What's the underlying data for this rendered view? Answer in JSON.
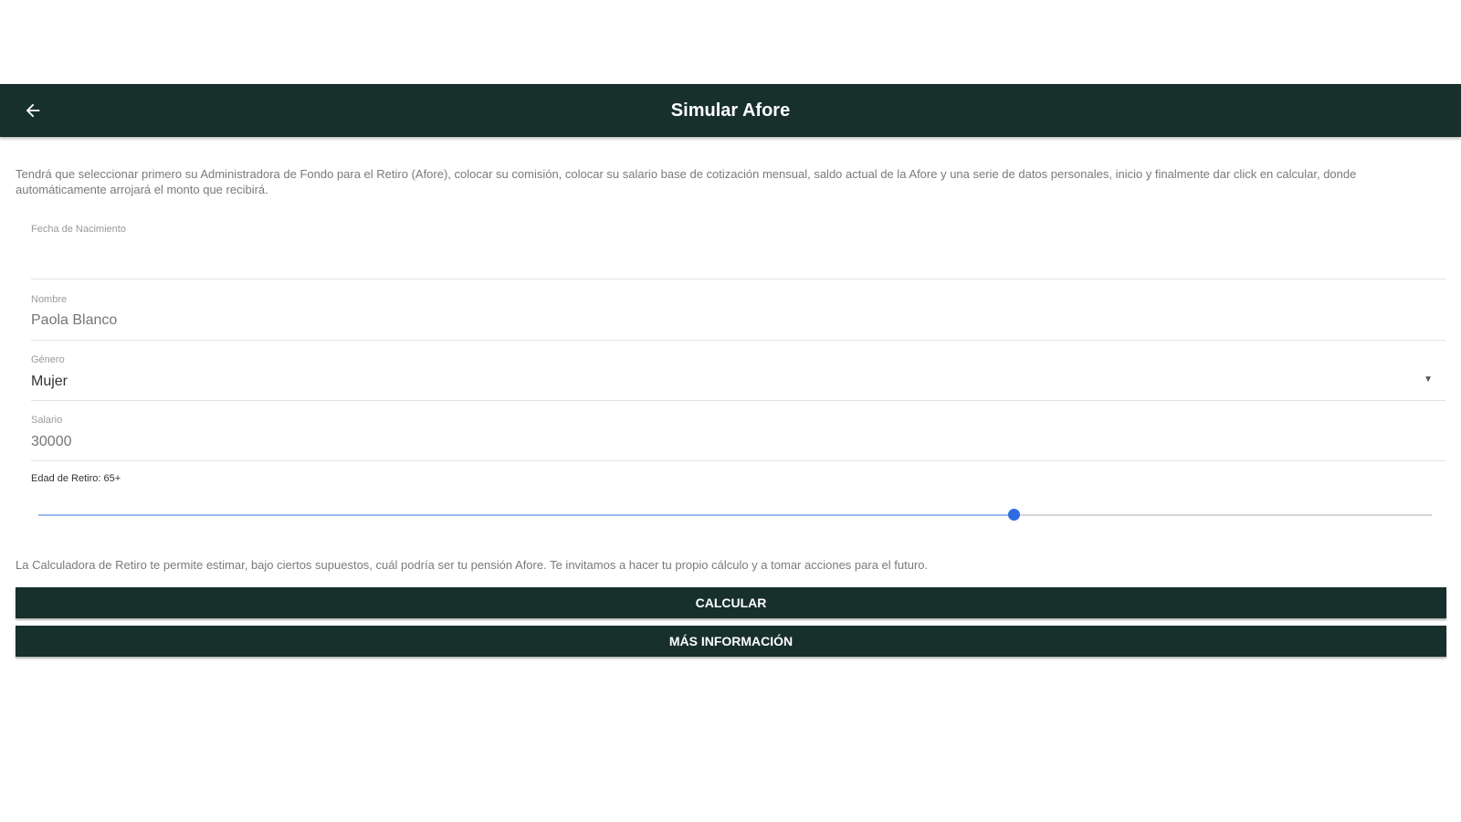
{
  "header": {
    "back_icon": "arrow-left-icon",
    "title": "Simular Afore"
  },
  "intro_text": "Tendrá que seleccionar primero su Administradora de Fondo para el Retiro (Afore), colocar su comisión, colocar su salario base de cotización mensual, saldo actual de la Afore y una serie de datos personales, inicio y finalmente dar click en calcular, donde automáticamente arrojará el monto que recibirá.",
  "form": {
    "birthdate": {
      "label": "Fecha de Nacimiento",
      "value": ""
    },
    "name": {
      "label": "Nombre",
      "placeholder": "Paola Blanco"
    },
    "gender": {
      "label": "Género",
      "selected": "Mujer",
      "arrow_icon": "dropdown-arrow-icon"
    },
    "salary": {
      "label": "Salario",
      "placeholder": "30000"
    },
    "retirement_age": {
      "label": "Edad de Retiro: 65+",
      "slider_fraction": 0.7
    }
  },
  "note_text": "La Calculadora de Retiro te permite estimar, bajo ciertos supuestos, cuál podría ser tu pensión Afore. Te invitamos a hacer tu propio cálculo y a tomar acciones para el futuro.",
  "buttons": {
    "calculate": "CALCULAR",
    "more_info": "MÁS INFORMACIÓN"
  },
  "colors": {
    "primary": "#17302b",
    "slider_accent": "#2d6de0"
  }
}
